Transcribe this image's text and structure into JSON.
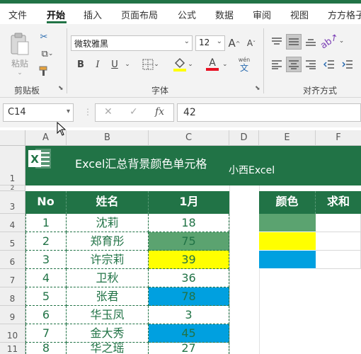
{
  "ribbon": {
    "tabs": [
      "文件",
      "开始",
      "插入",
      "页面布局",
      "公式",
      "数据",
      "审阅",
      "视图",
      "方方格子"
    ],
    "active_tab": "开始",
    "clipboard": {
      "paste_label": "粘贴",
      "group_label": "剪贴板"
    },
    "font": {
      "name": "微软雅黑",
      "size": "12",
      "bold": "B",
      "italic": "I",
      "underline": "U",
      "phonetic": "wén",
      "phonetic_char": "文",
      "grow": "A",
      "shrink": "A",
      "group_label": "字体"
    },
    "alignment": {
      "group_label": "对齐方式"
    },
    "colors": {
      "accent": "#217346",
      "highlight": "#ffff00",
      "font_color": "#e81123"
    }
  },
  "formula_bar": {
    "name_box": "C14",
    "fx": "fx",
    "cancel": "✕",
    "confirm": "✓",
    "value": "42"
  },
  "sheet": {
    "columns": [
      "A",
      "B",
      "C",
      "D",
      "E",
      "F"
    ],
    "rows": [
      "1",
      "2",
      "3",
      "4",
      "5",
      "6",
      "7",
      "8",
      "9",
      "10",
      "11"
    ],
    "banner_title": "Excel汇总背景颜色单元格",
    "banner_sub": "小西Excel",
    "table_headers": [
      "No",
      "姓名",
      "1月"
    ],
    "table_rows": [
      {
        "no": "1",
        "name": "沈莉",
        "value": "18",
        "fill": ""
      },
      {
        "no": "2",
        "name": "郑育彤",
        "value": "75",
        "fill": "#5ba370"
      },
      {
        "no": "3",
        "name": "许宗莉",
        "value": "39",
        "fill": "#ffff00"
      },
      {
        "no": "4",
        "name": "卫秋",
        "value": "36",
        "fill": ""
      },
      {
        "no": "5",
        "name": "张君",
        "value": "78",
        "fill": "#00a0e0"
      },
      {
        "no": "6",
        "name": "华玉凤",
        "value": "3",
        "fill": ""
      },
      {
        "no": "7",
        "name": "金大秀",
        "value": "45",
        "fill": "#00a0e0"
      },
      {
        "no": "8",
        "name": "华之瑶",
        "value": "27",
        "fill": ""
      }
    ],
    "summary_headers": [
      "颜色",
      "求和"
    ],
    "summary_colors": [
      "#5ba370",
      "#ffff00",
      "#00a0e0"
    ]
  }
}
